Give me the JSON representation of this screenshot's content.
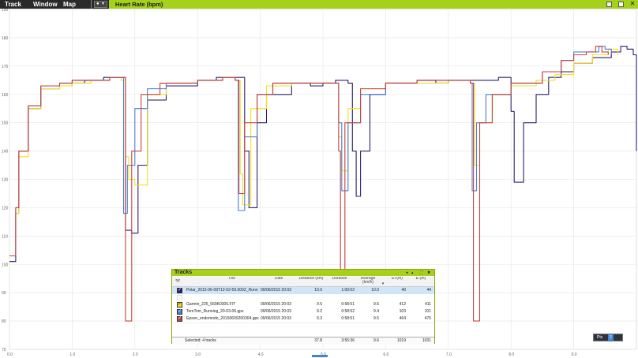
{
  "menu": {
    "items": [
      "Track",
      "Window",
      "Map"
    ],
    "dropdown_glyph": "▾"
  },
  "chart_title": "Heart Rate (bpm)",
  "toolbar_icons": [
    "export-icon",
    "restore-icon",
    "close-icon"
  ],
  "close_glyph": "✕",
  "chart_data": {
    "type": "line",
    "title": "Heart Rate (bpm)",
    "xlim": [
      0,
      10.0
    ],
    "ylim": [
      70,
      190
    ],
    "x_ticks": [
      "0.0",
      "1.0",
      "2.0",
      "3.0",
      "4.0",
      "5.0",
      "6.0",
      "7.0",
      "8.0",
      "9.0"
    ],
    "y_ticks": [
      "70",
      "80",
      "90",
      "100",
      "110",
      "120",
      "130",
      "140",
      "150",
      "160",
      "170",
      "180",
      "190"
    ],
    "grid": true,
    "series": [
      {
        "color": "#2a1f6e",
        "points": [
          [
            0,
            101
          ],
          [
            0.1,
            118
          ],
          [
            0.15,
            140
          ],
          [
            0.3,
            155
          ],
          [
            0.5,
            162
          ],
          [
            0.8,
            163
          ],
          [
            1.0,
            164
          ],
          [
            1.2,
            165
          ],
          [
            1.5,
            166
          ],
          [
            1.8,
            166
          ],
          [
            1.85,
            112
          ],
          [
            1.95,
            111
          ],
          [
            2.05,
            135
          ],
          [
            2.2,
            158
          ],
          [
            2.5,
            163
          ],
          [
            2.8,
            163
          ],
          [
            3.0,
            165
          ],
          [
            3.3,
            166
          ],
          [
            3.6,
            166
          ],
          [
            3.75,
            140
          ],
          [
            3.82,
            120
          ],
          [
            3.95,
            150
          ],
          [
            4.1,
            160
          ],
          [
            4.5,
            164
          ],
          [
            4.8,
            163
          ],
          [
            5.0,
            164
          ],
          [
            5.2,
            165
          ],
          [
            5.4,
            164
          ],
          [
            5.47,
            140
          ],
          [
            5.53,
            124
          ],
          [
            5.6,
            140
          ],
          [
            5.75,
            160
          ],
          [
            6.0,
            164
          ],
          [
            6.5,
            165
          ],
          [
            6.8,
            164
          ],
          [
            7.0,
            165
          ],
          [
            7.2,
            165
          ],
          [
            7.5,
            165
          ],
          [
            7.8,
            166
          ],
          [
            8.0,
            154
          ],
          [
            8.05,
            129
          ],
          [
            8.2,
            150
          ],
          [
            8.4,
            160
          ],
          [
            8.6,
            166
          ],
          [
            8.8,
            168
          ],
          [
            9.0,
            171
          ],
          [
            9.3,
            173
          ],
          [
            9.6,
            175
          ],
          [
            9.75,
            177
          ],
          [
            9.85,
            176
          ],
          [
            9.95,
            174
          ],
          [
            10.0,
            140
          ]
        ]
      },
      {
        "color": "#f0e020",
        "points": [
          [
            0,
            103
          ],
          [
            0.1,
            118
          ],
          [
            0.15,
            138
          ],
          [
            0.3,
            155
          ],
          [
            0.5,
            162
          ],
          [
            0.8,
            163
          ],
          [
            1.0,
            164
          ],
          [
            1.3,
            165
          ],
          [
            1.6,
            166
          ],
          [
            1.78,
            165
          ],
          [
            1.85,
            138
          ],
          [
            1.9,
            130
          ],
          [
            2.0,
            128
          ],
          [
            2.2,
            160
          ],
          [
            2.5,
            164
          ],
          [
            3.0,
            165
          ],
          [
            3.4,
            166
          ],
          [
            3.6,
            165
          ],
          [
            3.68,
            132
          ],
          [
            3.72,
            121
          ],
          [
            3.85,
            155
          ],
          [
            4.1,
            163
          ],
          [
            4.5,
            164
          ],
          [
            5.0,
            164
          ],
          [
            5.2,
            164
          ],
          [
            5.25,
            145
          ],
          [
            5.3,
            133
          ],
          [
            5.4,
            155
          ],
          [
            5.6,
            162
          ],
          [
            6.0,
            164
          ],
          [
            6.5,
            164
          ],
          [
            7.0,
            165
          ],
          [
            7.35,
            164
          ],
          [
            7.42,
            135
          ],
          [
            7.5,
            150
          ],
          [
            7.7,
            160
          ],
          [
            8.0,
            163
          ],
          [
            8.4,
            165
          ],
          [
            8.7,
            167
          ],
          [
            9.0,
            171
          ],
          [
            9.3,
            174
          ],
          [
            9.55,
            176
          ],
          [
            9.7,
            174
          ]
        ]
      },
      {
        "color": "#4a7fd0",
        "points": [
          [
            0,
            103
          ],
          [
            0.1,
            120
          ],
          [
            0.15,
            140
          ],
          [
            0.3,
            156
          ],
          [
            0.5,
            163
          ],
          [
            0.8,
            164
          ],
          [
            1.0,
            165
          ],
          [
            1.3,
            165
          ],
          [
            1.6,
            166
          ],
          [
            1.78,
            166
          ],
          [
            1.82,
            118
          ],
          [
            1.88,
            135
          ],
          [
            2.0,
            155
          ],
          [
            2.2,
            162
          ],
          [
            2.5,
            164
          ],
          [
            3.0,
            165
          ],
          [
            3.4,
            166
          ],
          [
            3.6,
            165
          ],
          [
            3.65,
            119
          ],
          [
            3.75,
            145
          ],
          [
            3.95,
            160
          ],
          [
            4.2,
            164
          ],
          [
            5.0,
            164
          ],
          [
            5.2,
            164
          ],
          [
            5.25,
            150
          ],
          [
            5.3,
            126
          ],
          [
            5.4,
            150
          ],
          [
            5.6,
            160
          ],
          [
            6.0,
            164
          ],
          [
            6.5,
            165
          ],
          [
            7.0,
            165
          ],
          [
            7.35,
            164
          ],
          [
            7.38,
            126
          ],
          [
            7.45,
            150
          ],
          [
            7.6,
            160
          ],
          [
            8.0,
            164
          ],
          [
            8.5,
            168
          ],
          [
            8.8,
            172
          ],
          [
            9.0,
            175
          ],
          [
            9.2,
            175
          ],
          [
            9.4,
            177
          ],
          [
            9.5,
            176
          ],
          [
            9.6,
            174
          ]
        ]
      },
      {
        "color": "#c8403c",
        "points": [
          [
            0,
            103
          ],
          [
            0.1,
            120
          ],
          [
            0.15,
            140
          ],
          [
            0.3,
            156
          ],
          [
            0.5,
            163
          ],
          [
            0.8,
            164
          ],
          [
            1.0,
            165
          ],
          [
            1.3,
            165
          ],
          [
            1.6,
            166
          ],
          [
            1.8,
            166
          ],
          [
            1.85,
            80
          ],
          [
            1.95,
            140
          ],
          [
            2.1,
            160
          ],
          [
            2.4,
            164
          ],
          [
            3.0,
            165
          ],
          [
            3.4,
            166
          ],
          [
            3.6,
            165
          ],
          [
            3.66,
            125
          ],
          [
            3.75,
            150
          ],
          [
            3.95,
            160
          ],
          [
            4.2,
            164
          ],
          [
            5.0,
            164
          ],
          [
            5.2,
            164
          ],
          [
            5.25,
            140
          ],
          [
            5.28,
            96
          ],
          [
            5.35,
            150
          ],
          [
            5.6,
            162
          ],
          [
            6.0,
            164
          ],
          [
            6.5,
            165
          ],
          [
            7.0,
            165
          ],
          [
            7.35,
            164
          ],
          [
            7.4,
            80
          ],
          [
            7.5,
            150
          ],
          [
            7.7,
            160
          ],
          [
            8.0,
            164
          ],
          [
            8.5,
            168
          ],
          [
            8.8,
            172
          ],
          [
            9.0,
            174
          ],
          [
            9.2,
            175
          ],
          [
            9.35,
            177
          ],
          [
            9.45,
            175
          ],
          [
            9.55,
            174
          ]
        ]
      }
    ]
  },
  "tracks_panel": {
    "title": "Tracks",
    "ctrl_glyphs": [
      "◂",
      "▴",
      "⛶",
      "✖"
    ],
    "columns": [
      "File",
      "Date",
      "Distance (km)",
      "Duration",
      "Average (km/h)",
      "E+(m)",
      "E-(m)"
    ],
    "sort_glyph": "▾",
    "rows": [
      {
        "file": "Polar_2015-06-09T12-02-59.000Z_Runn",
        "date": "09/06/2015 20:03",
        "distance": "10.0",
        "duration": "1:00:02",
        "avg": "10.0",
        "eplus": "40",
        "eminus": "44",
        "color": "#2a1f6e",
        "checked": true,
        "selected": true
      },
      {
        "file": "",
        "date": "",
        "distance": "",
        "duration": "",
        "avg": "",
        "eplus": "",
        "eminus": "",
        "color": "#ffffff",
        "checked": false,
        "selected": false
      },
      {
        "file": "Garmin_225_569K0305.FIT",
        "date": "09/06/2015 20:03",
        "distance": "9.5",
        "duration": "0:58:51",
        "avg": "9.6",
        "eplus": "412",
        "eminus": "411",
        "color": "#f0e020",
        "checked": true,
        "selected": false
      },
      {
        "file": "TomTom_Running_20-03-06.gpx",
        "date": "09/06/2015 20:03",
        "distance": "9.2",
        "duration": "0:58:52",
        "avg": "9.4",
        "eplus": "103",
        "eminus": "101",
        "color": "#4a7fd0",
        "checked": true,
        "selected": false
      },
      {
        "file": "Epson_endomodo_20150609200304.gpx",
        "date": "09/06/2015 20:03",
        "distance": "9.3",
        "duration": "0:58:51",
        "avg": "9.5",
        "eplus": "464",
        "eminus": "475",
        "color": "#c8403c",
        "checked": true,
        "selected": false
      }
    ],
    "footer": {
      "label": "Selected: 4 tracks",
      "distance": "37.8",
      "duration": "3:56:36",
      "avg": "9.6",
      "eplus": "1019",
      "eminus": "1031"
    }
  },
  "mini_nav": {
    "label": "Pts",
    "value": "2"
  }
}
